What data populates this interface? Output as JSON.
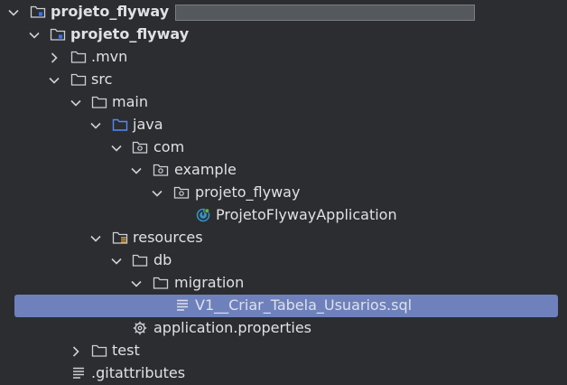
{
  "tree": {
    "root_label": "projeto_flyway",
    "module_label": "projeto_flyway",
    "mvn_label": ".mvn",
    "src_label": "src",
    "main_label": "main",
    "java_label": "java",
    "com_label": "com",
    "example_label": "example",
    "pkg_label": "projeto_flyway",
    "app_class_label": "ProjetoFlywayApplication",
    "resources_label": "resources",
    "db_label": "db",
    "migration_label": "migration",
    "sql_file_label": "V1__Criar_Tabela_Usuarios.sql",
    "props_label": "application.properties",
    "test_label": "test",
    "gitattributes_label": ".gitattributes"
  }
}
